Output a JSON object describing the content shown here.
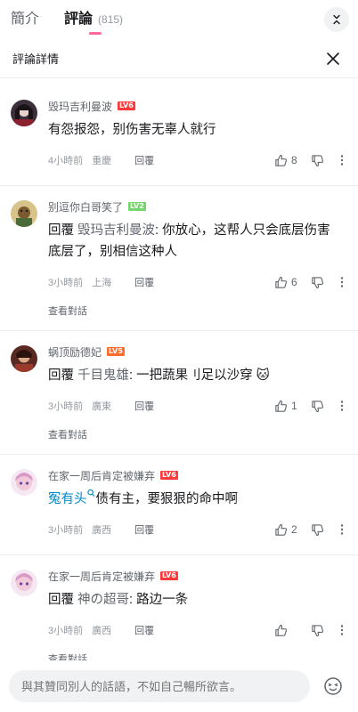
{
  "tabs": [
    {
      "label": "簡介",
      "count": ""
    },
    {
      "label": "評論",
      "count": "(815)"
    }
  ],
  "detail": {
    "title": "評論詳情"
  },
  "labels": {
    "reply": "回覆",
    "view_conversation": "查看對話",
    "reply_prefix": "回覆 "
  },
  "comments": [
    {
      "username": "毁玛吉利曼波",
      "level": "LV6",
      "text": "有怨报怨，别伤害无辜人就行",
      "time": "4小時前",
      "location": "重慶",
      "likes": "8"
    },
    {
      "username": "别逗你白哥笑了",
      "level": "LV2",
      "mention": "毁玛吉利曼波",
      "text": ": 你放心，这帮人只会底层伤害底层了，别相信这种人",
      "time": "3小時前",
      "location": "上海",
      "likes": "6"
    },
    {
      "username": "蜗顶励德妃",
      "level": "LV5",
      "mention": "千目鬼雄",
      "text": ": 一把蔬果刂足以沙穿 🐱",
      "time": "3小時前",
      "location": "廣東",
      "likes": "1"
    },
    {
      "username": "在家一周后肯定被嫌弃",
      "level": "LV6",
      "link": "冤有头",
      "text": "债有主，要狠狠的命中啊",
      "time": "3小時前",
      "location": "廣西",
      "likes": "2"
    },
    {
      "username": "在家一周后肯定被嫌弃",
      "level": "LV6",
      "mention": "神の超哥",
      "text": ": 路边一条",
      "time": "3小時前",
      "location": "廣西",
      "likes": ""
    }
  ],
  "input": {
    "placeholder": "與其贊同別人的話語，不如自己暢所欲言。"
  },
  "icons": {
    "collapse": "collapse-icon",
    "close": "close-icon",
    "like": "thumbs-up-icon",
    "dislike": "thumbs-down-icon",
    "more": "more-vertical-icon",
    "search": "search-icon",
    "emoji": "emoji-icon"
  },
  "colors": {
    "accent": "#ff6699",
    "link": "#008ac5",
    "lv6": "#ff3a3a",
    "lv5": "#ff6d2e",
    "lv2": "#75d66b"
  }
}
